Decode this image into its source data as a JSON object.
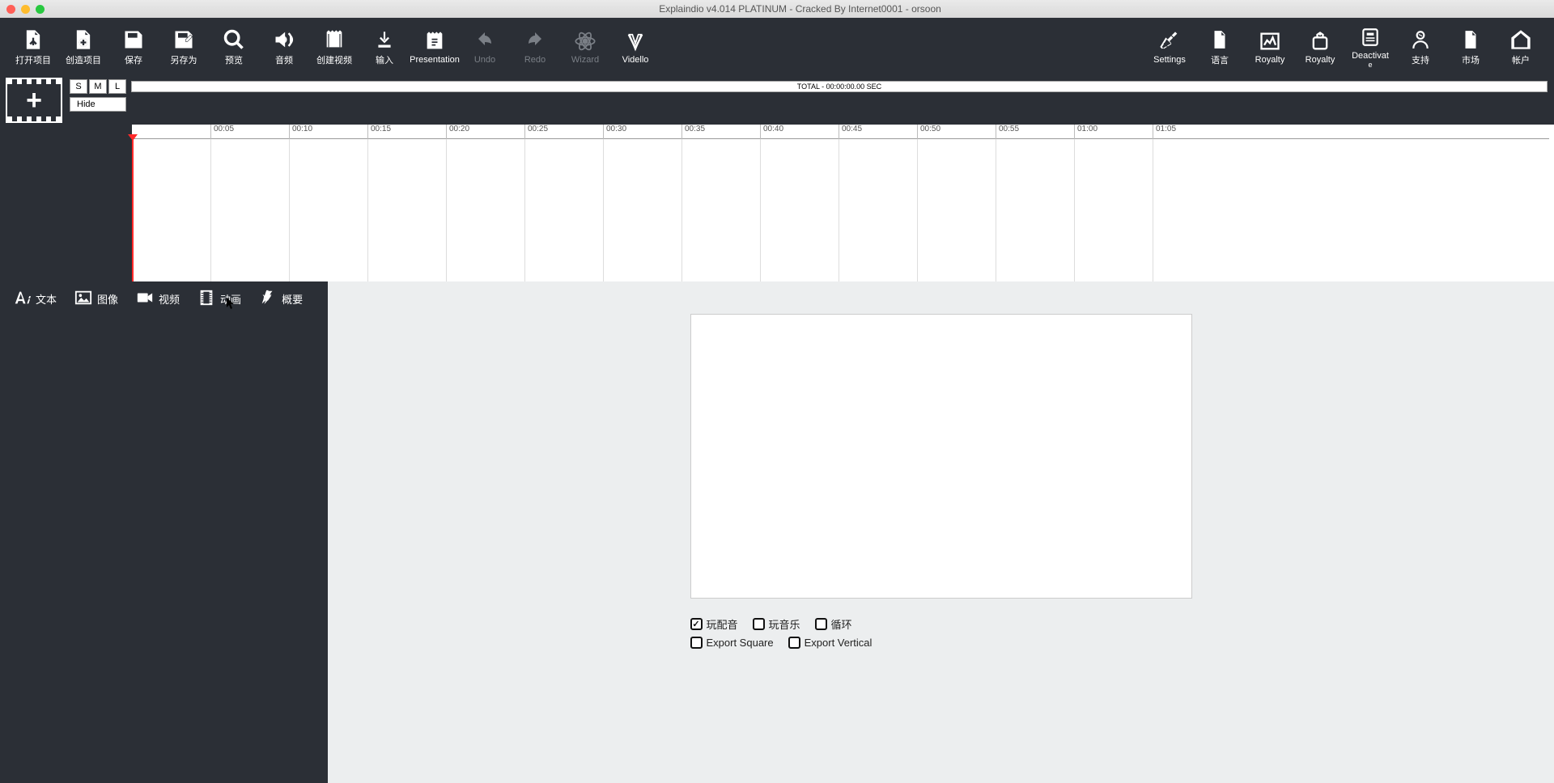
{
  "window": {
    "title": "Explaindio v4.014 PLATINUM - Cracked By Internet0001 - orsoon"
  },
  "toolbar_left": [
    {
      "id": "open-project",
      "label": "打开项目"
    },
    {
      "id": "create-project",
      "label": "创造项目"
    },
    {
      "id": "save",
      "label": "保存"
    },
    {
      "id": "save-as",
      "label": "另存为"
    },
    {
      "id": "preview",
      "label": "预览"
    },
    {
      "id": "audio",
      "label": "音频"
    },
    {
      "id": "create-video",
      "label": "创建视频"
    },
    {
      "id": "input",
      "label": "输入"
    },
    {
      "id": "presentation",
      "label": "Presentation"
    },
    {
      "id": "undo",
      "label": "Undo",
      "dim": true
    },
    {
      "id": "redo",
      "label": "Redo",
      "dim": true
    },
    {
      "id": "wizard",
      "label": "Wizard",
      "dim": true
    },
    {
      "id": "vidello",
      "label": "Vidello"
    }
  ],
  "toolbar_right": [
    {
      "id": "settings",
      "label": "Settings"
    },
    {
      "id": "language",
      "label": "语言"
    },
    {
      "id": "royalty1",
      "label": "Royalty"
    },
    {
      "id": "royalty2",
      "label": "Royalty"
    },
    {
      "id": "deactivate",
      "label": "Deactivat",
      "label2": "e"
    },
    {
      "id": "support",
      "label": "支持"
    },
    {
      "id": "market",
      "label": "市场"
    },
    {
      "id": "account",
      "label": "帐户"
    }
  ],
  "timeline": {
    "size_buttons": [
      "S",
      "M",
      "L"
    ],
    "hide_label": "Hide",
    "total_label": "TOTAL - 00:00:00.00 SEC",
    "ticks": [
      "00:05",
      "00:10",
      "00:15",
      "00:20",
      "00:25",
      "00:30",
      "00:35",
      "00:40",
      "00:45",
      "00:50",
      "00:55",
      "01:00",
      "01:05"
    ]
  },
  "tabs": [
    {
      "id": "text",
      "label": "文本"
    },
    {
      "id": "image",
      "label": "图像"
    },
    {
      "id": "video",
      "label": "视频"
    },
    {
      "id": "animation",
      "label": "动画"
    },
    {
      "id": "summary",
      "label": "概要"
    }
  ],
  "options_row1": [
    {
      "id": "play-voiceover",
      "label": "玩配音",
      "checked": true
    },
    {
      "id": "play-music",
      "label": "玩音乐",
      "checked": false
    },
    {
      "id": "loop",
      "label": "循环",
      "checked": false
    }
  ],
  "options_row2": [
    {
      "id": "export-square",
      "label": "Export Square",
      "checked": false
    },
    {
      "id": "export-vertical",
      "label": "Export Vertical",
      "checked": false
    }
  ]
}
